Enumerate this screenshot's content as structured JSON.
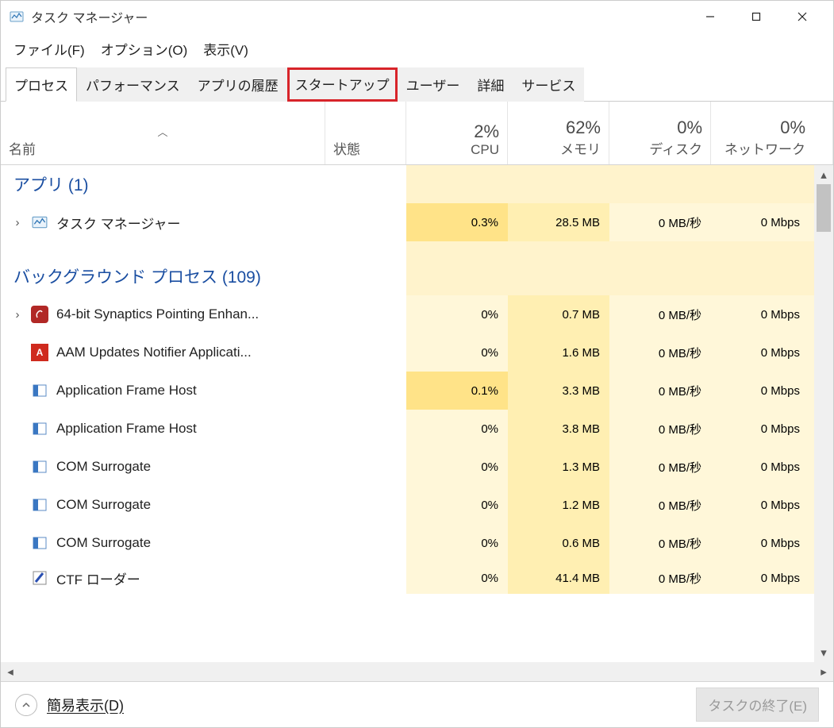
{
  "window": {
    "title": "タスク マネージャー"
  },
  "menu": {
    "file": "ファイル(F)",
    "options": "オプション(O)",
    "view": "表示(V)"
  },
  "tabs": {
    "processes": "プロセス",
    "performance": "パフォーマンス",
    "app_history": "アプリの履歴",
    "startup": "スタートアップ",
    "users": "ユーザー",
    "details": "詳細",
    "services": "サービス"
  },
  "columns": {
    "name": "名前",
    "state": "状態",
    "cpu_pct": "2%",
    "cpu": "CPU",
    "mem_pct": "62%",
    "mem": "メモリ",
    "disk_pct": "0%",
    "disk": "ディスク",
    "net_pct": "0%",
    "net": "ネットワーク"
  },
  "groups": {
    "apps": {
      "label": "アプリ (1)"
    },
    "bg": {
      "label": "バックグラウンド プロセス (109)"
    }
  },
  "rows": [
    {
      "icon": "taskmgr",
      "expandable": true,
      "name": "タスク マネージャー",
      "cpu": "0.3%",
      "cpu_heat": "c",
      "mem": "28.5 MB",
      "mem_heat": "b",
      "disk": "0 MB/秒",
      "disk_heat": "a",
      "net": "0 Mbps",
      "net_heat": "a"
    },
    {
      "icon": "syn",
      "expandable": true,
      "name": "64-bit Synaptics Pointing Enhan...",
      "cpu": "0%",
      "cpu_heat": "a",
      "mem": "0.7 MB",
      "mem_heat": "b",
      "disk": "0 MB/秒",
      "disk_heat": "a",
      "net": "0 Mbps",
      "net_heat": "a"
    },
    {
      "icon": "adobe",
      "expandable": false,
      "name": "AAM Updates Notifier Applicati...",
      "cpu": "0%",
      "cpu_heat": "a",
      "mem": "1.6 MB",
      "mem_heat": "b",
      "disk": "0 MB/秒",
      "disk_heat": "a",
      "net": "0 Mbps",
      "net_heat": "a"
    },
    {
      "icon": "app",
      "expandable": false,
      "name": "Application Frame Host",
      "cpu": "0.1%",
      "cpu_heat": "c",
      "mem": "3.3 MB",
      "mem_heat": "b",
      "disk": "0 MB/秒",
      "disk_heat": "a",
      "net": "0 Mbps",
      "net_heat": "a"
    },
    {
      "icon": "app",
      "expandable": false,
      "name": "Application Frame Host",
      "cpu": "0%",
      "cpu_heat": "a",
      "mem": "3.8 MB",
      "mem_heat": "b",
      "disk": "0 MB/秒",
      "disk_heat": "a",
      "net": "0 Mbps",
      "net_heat": "a"
    },
    {
      "icon": "app",
      "expandable": false,
      "name": "COM Surrogate",
      "cpu": "0%",
      "cpu_heat": "a",
      "mem": "1.3 MB",
      "mem_heat": "b",
      "disk": "0 MB/秒",
      "disk_heat": "a",
      "net": "0 Mbps",
      "net_heat": "a"
    },
    {
      "icon": "app",
      "expandable": false,
      "name": "COM Surrogate",
      "cpu": "0%",
      "cpu_heat": "a",
      "mem": "1.2 MB",
      "mem_heat": "b",
      "disk": "0 MB/秒",
      "disk_heat": "a",
      "net": "0 Mbps",
      "net_heat": "a"
    },
    {
      "icon": "app",
      "expandable": false,
      "name": "COM Surrogate",
      "cpu": "0%",
      "cpu_heat": "a",
      "mem": "0.6 MB",
      "mem_heat": "b",
      "disk": "0 MB/秒",
      "disk_heat": "a",
      "net": "0 Mbps",
      "net_heat": "a"
    },
    {
      "icon": "ctf",
      "expandable": false,
      "name": "CTF ローダー",
      "cpu": "0%",
      "cpu_heat": "a",
      "mem": "41.4 MB",
      "mem_heat": "b",
      "disk": "0 MB/秒",
      "disk_heat": "a",
      "net": "0 Mbps",
      "net_heat": "a"
    }
  ],
  "footer": {
    "fewer": "簡易表示(D)",
    "endtask": "タスクの終了(E)"
  }
}
